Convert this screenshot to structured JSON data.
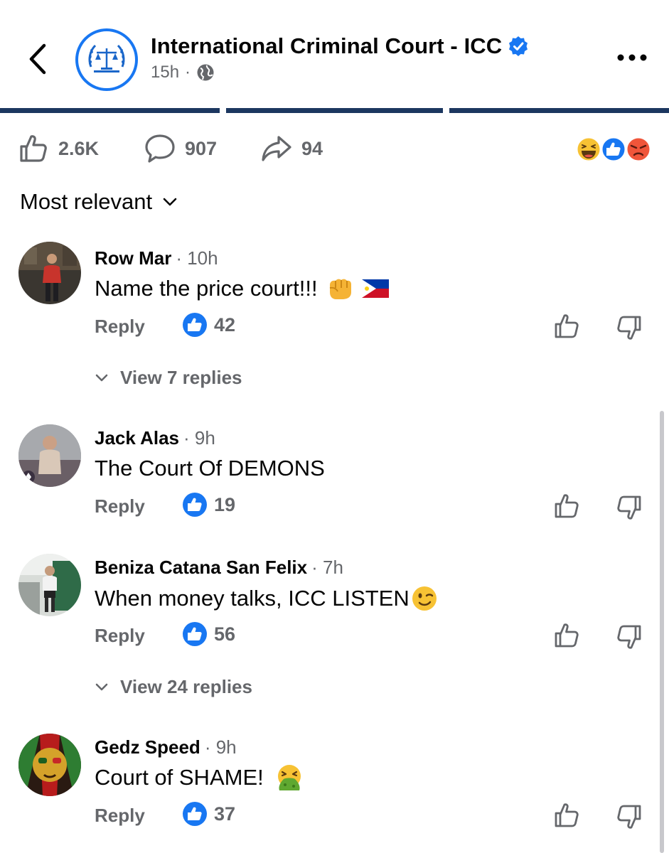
{
  "header": {
    "page_name": "International Criminal Court - ICC",
    "time": "15h",
    "separator": "·"
  },
  "stats": {
    "likes": "2.6K",
    "comments": "907",
    "shares": "94"
  },
  "sort": {
    "label": "Most relevant"
  },
  "comments": [
    {
      "name": "Row Mar",
      "time": "· 10h",
      "text": "Name the price court!!!",
      "reply_label": "Reply",
      "likes": "42",
      "view_replies": "View 7 replies",
      "emojis": [
        "fist-emoji",
        "philippines-flag-emoji"
      ]
    },
    {
      "name": "Jack Alas",
      "time": "· 9h",
      "text": "The Court Of DEMONS",
      "reply_label": "Reply",
      "likes": "19",
      "view_replies": "",
      "emojis": []
    },
    {
      "name": "Beniza Catana San Felix",
      "time": "· 7h",
      "text": "When money talks, ICC LISTEN",
      "reply_label": "Reply",
      "likes": "56",
      "view_replies": "View 24 replies",
      "emojis": [
        "winking-face-emoji"
      ]
    },
    {
      "name": "Gedz Speed",
      "time": "· 9h",
      "text": "Court of SHAME!",
      "reply_label": "Reply",
      "likes": "37",
      "view_replies": "",
      "emojis": [
        "vomiting-face-emoji"
      ]
    }
  ],
  "colors": {
    "accent": "#1877f2",
    "progress": "#1c3760",
    "muted": "#65676b"
  }
}
